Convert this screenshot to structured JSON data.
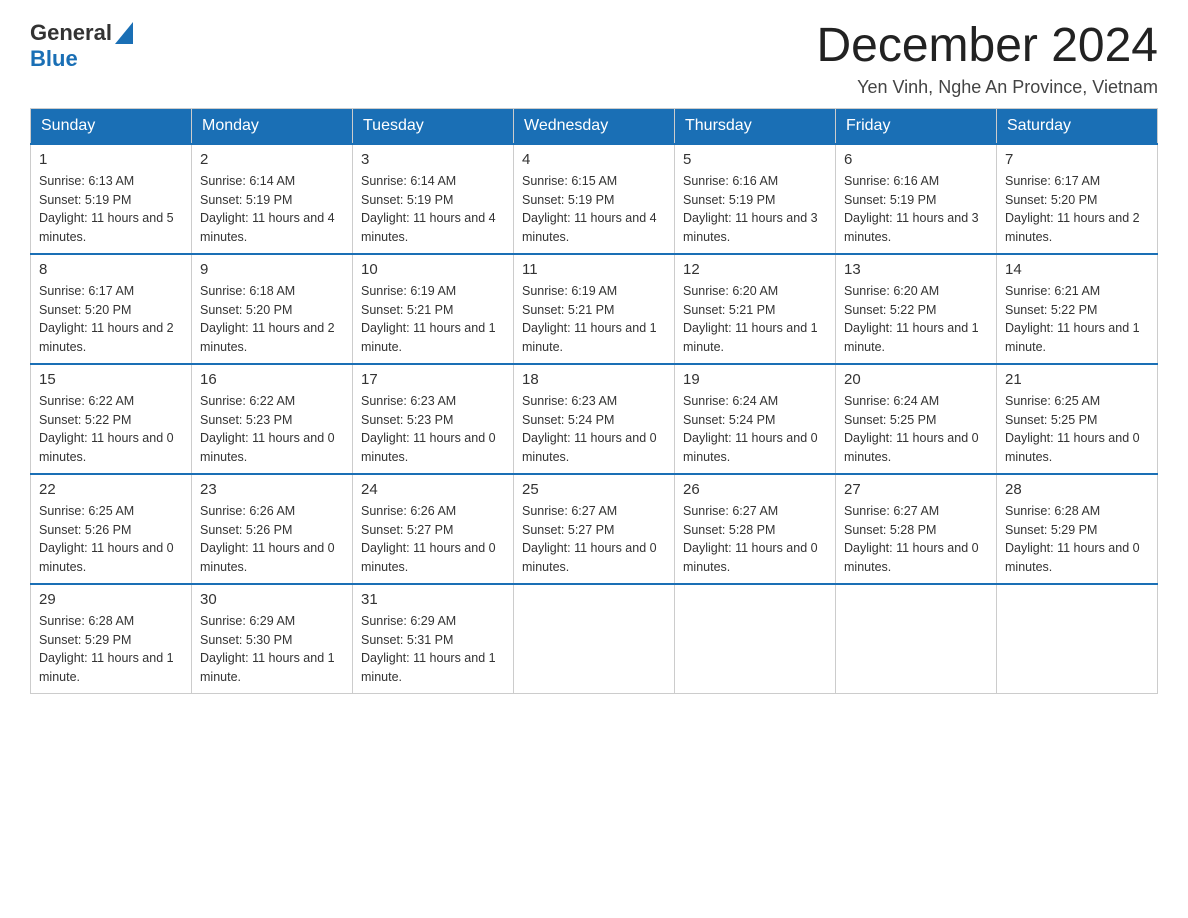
{
  "header": {
    "logo_general": "General",
    "logo_blue": "Blue",
    "month_year": "December 2024",
    "location": "Yen Vinh, Nghe An Province, Vietnam"
  },
  "days_of_week": [
    "Sunday",
    "Monday",
    "Tuesday",
    "Wednesday",
    "Thursday",
    "Friday",
    "Saturday"
  ],
  "weeks": [
    [
      {
        "day": "1",
        "sunrise": "6:13 AM",
        "sunset": "5:19 PM",
        "daylight": "11 hours and 5 minutes."
      },
      {
        "day": "2",
        "sunrise": "6:14 AM",
        "sunset": "5:19 PM",
        "daylight": "11 hours and 4 minutes."
      },
      {
        "day": "3",
        "sunrise": "6:14 AM",
        "sunset": "5:19 PM",
        "daylight": "11 hours and 4 minutes."
      },
      {
        "day": "4",
        "sunrise": "6:15 AM",
        "sunset": "5:19 PM",
        "daylight": "11 hours and 4 minutes."
      },
      {
        "day": "5",
        "sunrise": "6:16 AM",
        "sunset": "5:19 PM",
        "daylight": "11 hours and 3 minutes."
      },
      {
        "day": "6",
        "sunrise": "6:16 AM",
        "sunset": "5:19 PM",
        "daylight": "11 hours and 3 minutes."
      },
      {
        "day": "7",
        "sunrise": "6:17 AM",
        "sunset": "5:20 PM",
        "daylight": "11 hours and 2 minutes."
      }
    ],
    [
      {
        "day": "8",
        "sunrise": "6:17 AM",
        "sunset": "5:20 PM",
        "daylight": "11 hours and 2 minutes."
      },
      {
        "day": "9",
        "sunrise": "6:18 AM",
        "sunset": "5:20 PM",
        "daylight": "11 hours and 2 minutes."
      },
      {
        "day": "10",
        "sunrise": "6:19 AM",
        "sunset": "5:21 PM",
        "daylight": "11 hours and 1 minute."
      },
      {
        "day": "11",
        "sunrise": "6:19 AM",
        "sunset": "5:21 PM",
        "daylight": "11 hours and 1 minute."
      },
      {
        "day": "12",
        "sunrise": "6:20 AM",
        "sunset": "5:21 PM",
        "daylight": "11 hours and 1 minute."
      },
      {
        "day": "13",
        "sunrise": "6:20 AM",
        "sunset": "5:22 PM",
        "daylight": "11 hours and 1 minute."
      },
      {
        "day": "14",
        "sunrise": "6:21 AM",
        "sunset": "5:22 PM",
        "daylight": "11 hours and 1 minute."
      }
    ],
    [
      {
        "day": "15",
        "sunrise": "6:22 AM",
        "sunset": "5:22 PM",
        "daylight": "11 hours and 0 minutes."
      },
      {
        "day": "16",
        "sunrise": "6:22 AM",
        "sunset": "5:23 PM",
        "daylight": "11 hours and 0 minutes."
      },
      {
        "day": "17",
        "sunrise": "6:23 AM",
        "sunset": "5:23 PM",
        "daylight": "11 hours and 0 minutes."
      },
      {
        "day": "18",
        "sunrise": "6:23 AM",
        "sunset": "5:24 PM",
        "daylight": "11 hours and 0 minutes."
      },
      {
        "day": "19",
        "sunrise": "6:24 AM",
        "sunset": "5:24 PM",
        "daylight": "11 hours and 0 minutes."
      },
      {
        "day": "20",
        "sunrise": "6:24 AM",
        "sunset": "5:25 PM",
        "daylight": "11 hours and 0 minutes."
      },
      {
        "day": "21",
        "sunrise": "6:25 AM",
        "sunset": "5:25 PM",
        "daylight": "11 hours and 0 minutes."
      }
    ],
    [
      {
        "day": "22",
        "sunrise": "6:25 AM",
        "sunset": "5:26 PM",
        "daylight": "11 hours and 0 minutes."
      },
      {
        "day": "23",
        "sunrise": "6:26 AM",
        "sunset": "5:26 PM",
        "daylight": "11 hours and 0 minutes."
      },
      {
        "day": "24",
        "sunrise": "6:26 AM",
        "sunset": "5:27 PM",
        "daylight": "11 hours and 0 minutes."
      },
      {
        "day": "25",
        "sunrise": "6:27 AM",
        "sunset": "5:27 PM",
        "daylight": "11 hours and 0 minutes."
      },
      {
        "day": "26",
        "sunrise": "6:27 AM",
        "sunset": "5:28 PM",
        "daylight": "11 hours and 0 minutes."
      },
      {
        "day": "27",
        "sunrise": "6:27 AM",
        "sunset": "5:28 PM",
        "daylight": "11 hours and 0 minutes."
      },
      {
        "day": "28",
        "sunrise": "6:28 AM",
        "sunset": "5:29 PM",
        "daylight": "11 hours and 0 minutes."
      }
    ],
    [
      {
        "day": "29",
        "sunrise": "6:28 AM",
        "sunset": "5:29 PM",
        "daylight": "11 hours and 1 minute."
      },
      {
        "day": "30",
        "sunrise": "6:29 AM",
        "sunset": "5:30 PM",
        "daylight": "11 hours and 1 minute."
      },
      {
        "day": "31",
        "sunrise": "6:29 AM",
        "sunset": "5:31 PM",
        "daylight": "11 hours and 1 minute."
      },
      null,
      null,
      null,
      null
    ]
  ],
  "labels": {
    "sunrise": "Sunrise:",
    "sunset": "Sunset:",
    "daylight": "Daylight:"
  }
}
